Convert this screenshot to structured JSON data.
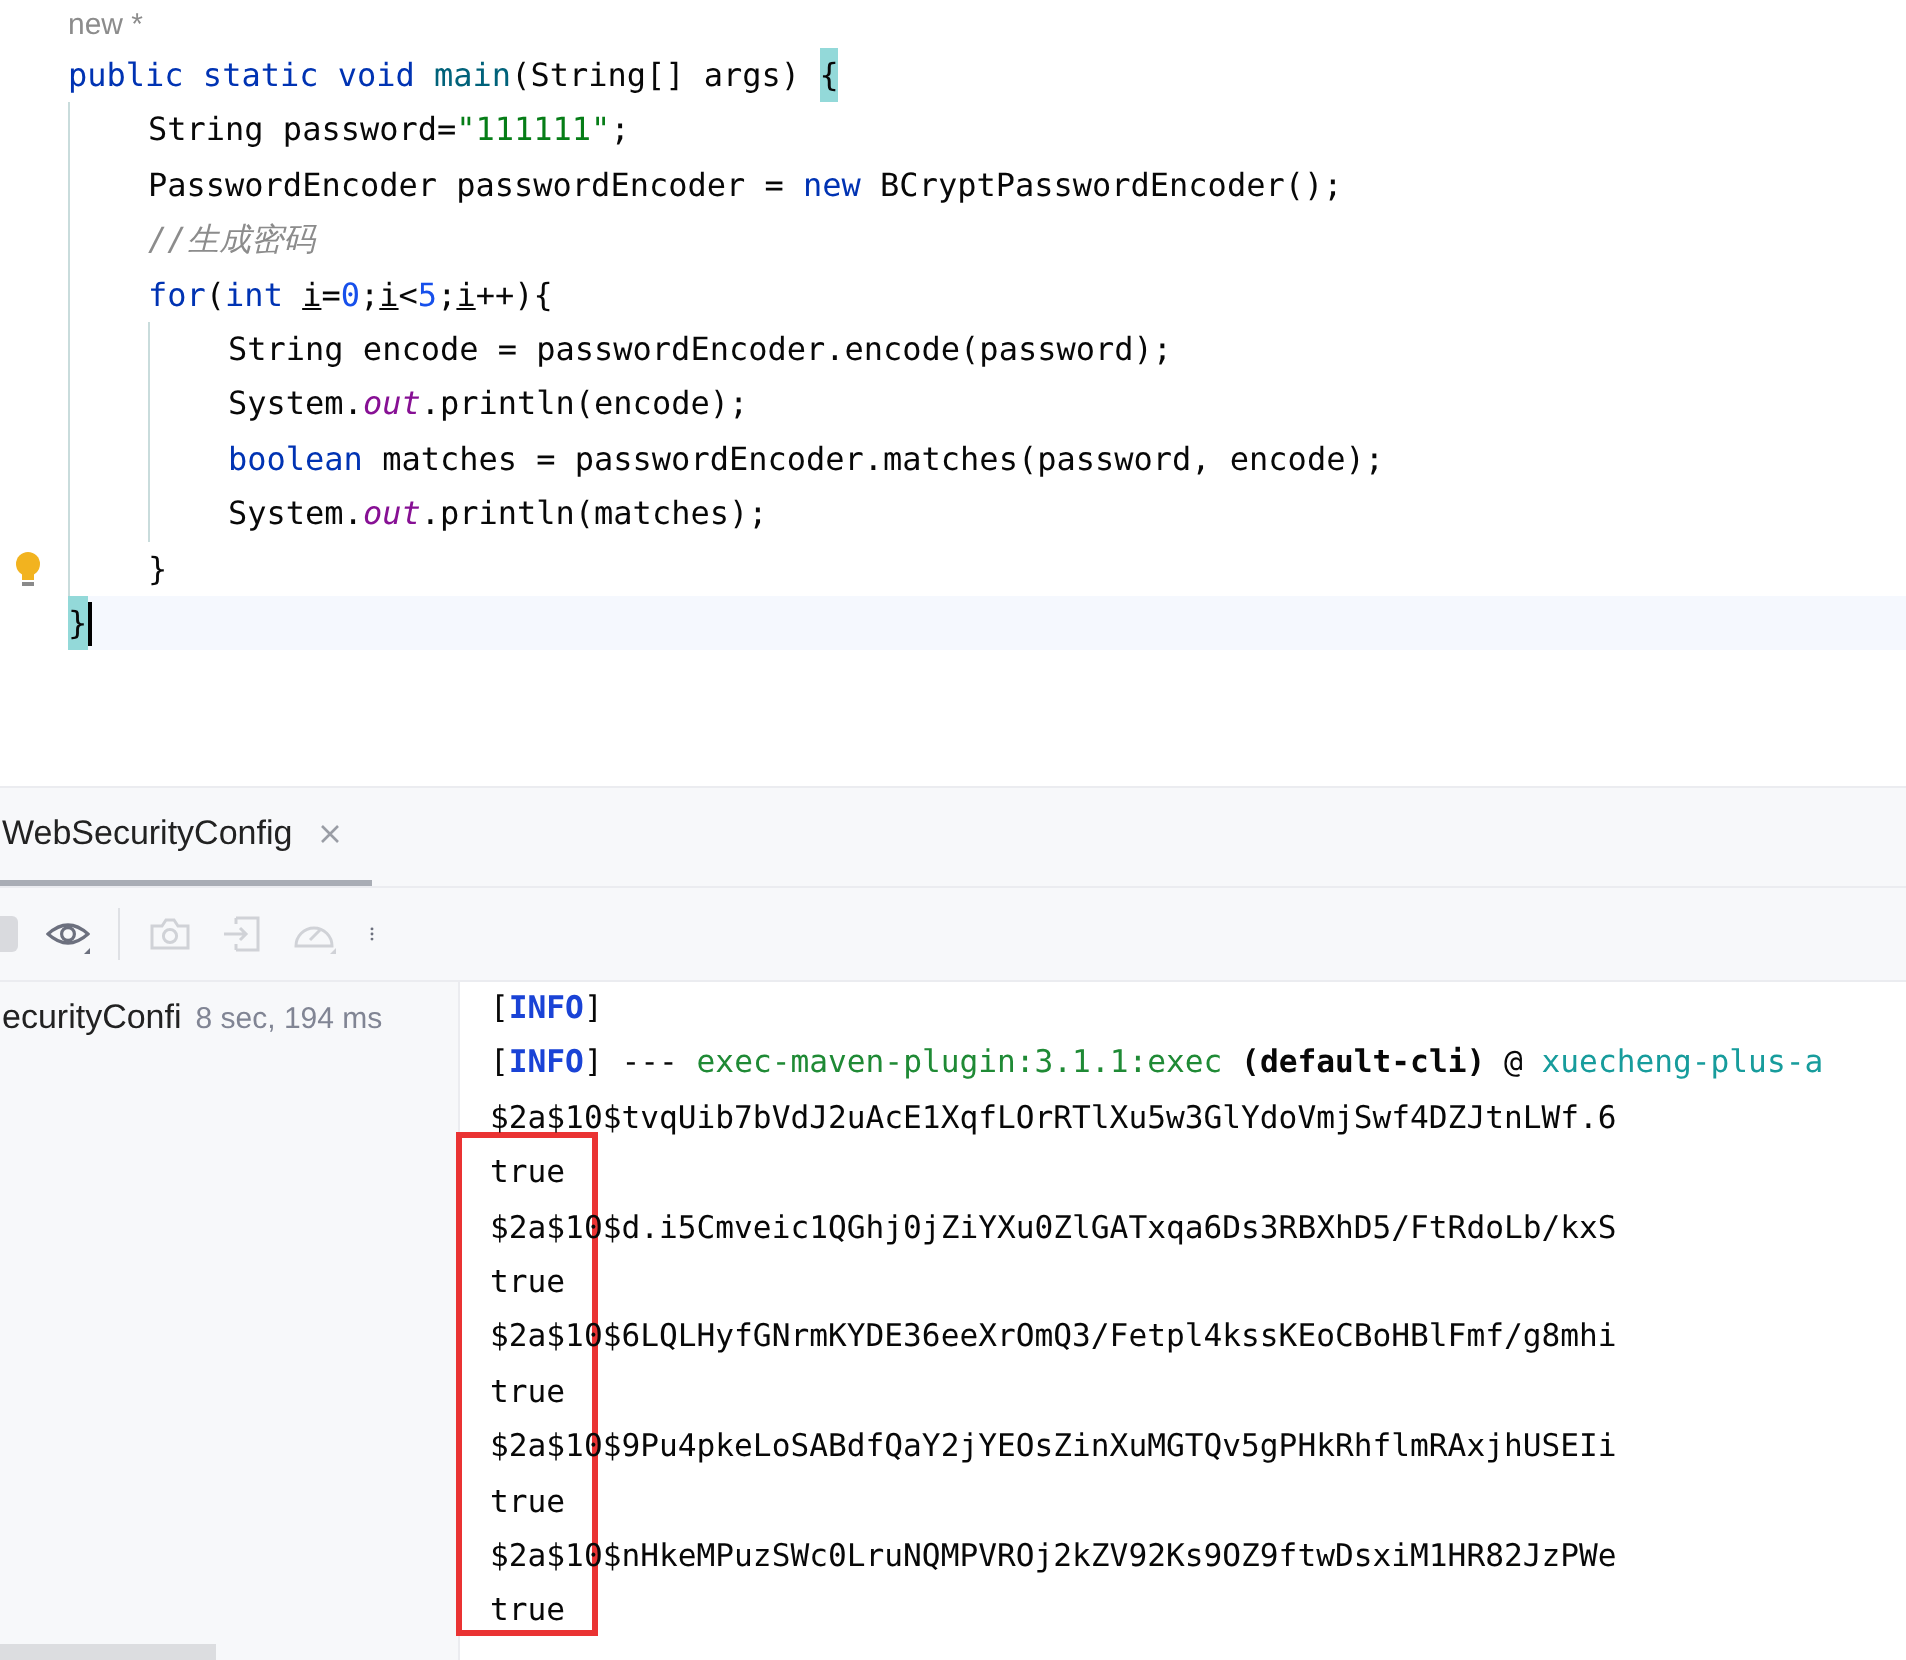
{
  "editor": {
    "hint": "new *",
    "lines": [
      {
        "tokens": [
          {
            "text": "public static void ",
            "kind": "keyword"
          },
          {
            "text": "main",
            "kind": "method"
          },
          {
            "text": "(String[] args) ",
            "kind": "plain"
          },
          {
            "text": "{",
            "kind": "brace-match"
          }
        ],
        "children": [
          {
            "tokens": [
              {
                "text": "String password=",
                "kind": "plain"
              },
              {
                "text": "\"111111\"",
                "kind": "string"
              },
              {
                "text": ";",
                "kind": "plain"
              }
            ]
          },
          {
            "tokens": [
              {
                "text": "PasswordEncoder passwordEncoder = ",
                "kind": "plain"
              },
              {
                "text": "new ",
                "kind": "keyword"
              },
              {
                "text": "BCryptPasswordEncoder();",
                "kind": "plain"
              }
            ]
          },
          {
            "tokens": [
              {
                "text": "//生成密码",
                "kind": "comment"
              }
            ]
          },
          {
            "tokens": [
              {
                "text": "for",
                "kind": "keyword"
              },
              {
                "text": "(",
                "kind": "plain"
              },
              {
                "text": "int ",
                "kind": "keyword"
              },
              {
                "text": "i",
                "kind": "reassigned"
              },
              {
                "text": "=",
                "kind": "plain"
              },
              {
                "text": "0",
                "kind": "number"
              },
              {
                "text": ";",
                "kind": "plain"
              },
              {
                "text": "i",
                "kind": "reassigned"
              },
              {
                "text": "<",
                "kind": "plain"
              },
              {
                "text": "5",
                "kind": "number"
              },
              {
                "text": ";",
                "kind": "plain"
              },
              {
                "text": "i",
                "kind": "reassigned"
              },
              {
                "text": "++){",
                "kind": "plain"
              }
            ],
            "children": [
              {
                "tokens": [
                  {
                    "text": "String encode = passwordEncoder.encode(password);",
                    "kind": "plain"
                  }
                ]
              },
              {
                "tokens": [
                  {
                    "text": "System.",
                    "kind": "plain"
                  },
                  {
                    "text": "out",
                    "kind": "static-field"
                  },
                  {
                    "text": ".println(encode);",
                    "kind": "plain"
                  }
                ]
              },
              {
                "tokens": [
                  {
                    "text": "boolean ",
                    "kind": "keyword"
                  },
                  {
                    "text": "matches = passwordEncoder.matches(password, encode);",
                    "kind": "plain"
                  }
                ]
              },
              {
                "tokens": [
                  {
                    "text": "System.",
                    "kind": "plain"
                  },
                  {
                    "text": "out",
                    "kind": "static-field"
                  },
                  {
                    "text": ".println(matches);",
                    "kind": "plain"
                  }
                ]
              }
            ]
          },
          {
            "tokens": [
              {
                "text": "}",
                "kind": "plain"
              }
            ],
            "intention": true
          }
        ]
      },
      {
        "tokens": [
          {
            "text": "}",
            "kind": "brace-match"
          }
        ],
        "current": true,
        "caret": true
      }
    ]
  },
  "run_window": {
    "tabs": [
      {
        "label": "WebSecurityConfig",
        "selected": true
      }
    ],
    "toolbar": [
      {
        "kind": "stop",
        "disabled": true
      },
      {
        "kind": "eye",
        "disabled": false
      },
      {
        "kind": "separator"
      },
      {
        "kind": "camera",
        "disabled": true
      },
      {
        "kind": "enter",
        "disabled": true
      },
      {
        "kind": "gauge",
        "disabled": true
      },
      {
        "kind": "more",
        "disabled": false
      }
    ],
    "runs": [
      {
        "name": "ecurityConfi",
        "duration": "8 sec, 194 ms"
      }
    ],
    "console": {
      "highlight_box": true,
      "lines": [
        [
          {
            "text": "[",
            "kind": "plain"
          },
          {
            "text": "INFO",
            "kind": "level"
          },
          {
            "text": "]",
            "kind": "plain"
          }
        ],
        [
          {
            "text": "[",
            "kind": "plain"
          },
          {
            "text": "INFO",
            "kind": "level"
          },
          {
            "text": "] --- ",
            "kind": "plain"
          },
          {
            "text": "exec-maven-plugin:3.1.1:exec",
            "kind": "plugin"
          },
          {
            "text": " (default-cli)",
            "kind": "bold"
          },
          {
            "text": " @ ",
            "kind": "plain"
          },
          {
            "text": "xuecheng-plus-a",
            "kind": "project"
          }
        ],
        [
          {
            "text": "$2a$10$tvqUib7bVdJ2uAcE1XqfLOrRTlXu5w3GlYdoVmjSwf4DZJtnLWf.6",
            "kind": "plain"
          }
        ],
        [
          {
            "text": "true",
            "kind": "plain"
          }
        ],
        [
          {
            "text": "$2a$10$d.i5Cmveic1QGhj0jZiYXu0ZlGATxqa6Ds3RBXhD5/FtRdoLb/kxS",
            "kind": "plain"
          }
        ],
        [
          {
            "text": "true",
            "kind": "plain"
          }
        ],
        [
          {
            "text": "$2a$10$6LQLHyfGNrmKYDE36eeXrOmQ3/Fetpl4kssKEoCBoHBlFmf/g8mhi",
            "kind": "plain"
          }
        ],
        [
          {
            "text": "true",
            "kind": "plain"
          }
        ],
        [
          {
            "text": "$2a$10$9Pu4pkeLoSABdfQaY2jYEOsZinXuMGTQv5gPHkRhflmRAxjhUSEIi",
            "kind": "plain"
          }
        ],
        [
          {
            "text": "true",
            "kind": "plain"
          }
        ],
        [
          {
            "text": "$2a$10$nHkeMPuzSWc0LruNQMPVROj2kZV92Ks9OZ9ftwDsxiM1HR82JzPWe",
            "kind": "plain"
          }
        ],
        [
          {
            "text": "true",
            "kind": "plain"
          }
        ]
      ]
    }
  }
}
